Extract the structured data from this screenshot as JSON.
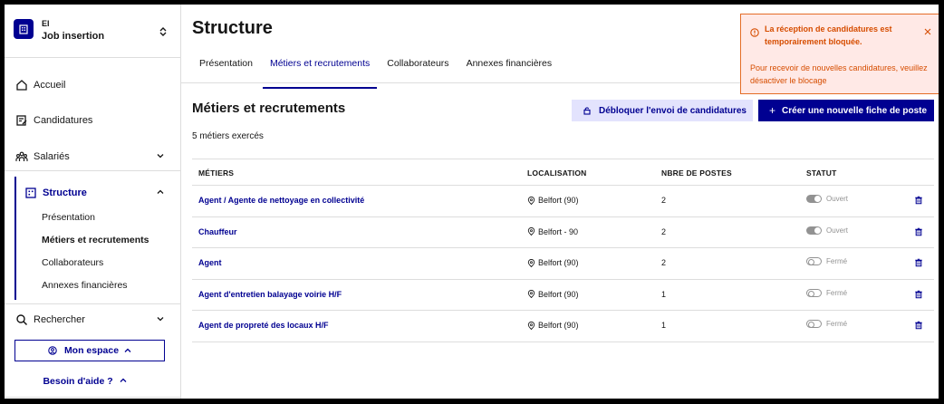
{
  "sidebar": {
    "org_short": "EI",
    "org_name": "Job insertion",
    "nav": {
      "accueil": "Accueil",
      "candidatures": "Candidatures",
      "salaries": "Salariés",
      "structure": "Structure",
      "rechercher": "Rechercher"
    },
    "structure_sub": [
      "Présentation",
      "Métiers et recrutements",
      "Collaborateurs",
      "Annexes financières"
    ],
    "mon_espace": "Mon espace",
    "besoin_aide": "Besoin d'aide ?"
  },
  "page": {
    "title": "Structure",
    "tabs": [
      "Présentation",
      "Métiers et recrutements",
      "Collaborateurs",
      "Annexes financières"
    ],
    "active_tab": "Métiers et recrutements",
    "section_title": "Métiers et recrutements",
    "count": "5 métiers exercés",
    "btn_unblock": "Débloquer l'envoi de candidatures",
    "btn_create": "Créer une nouvelle fiche de poste"
  },
  "table": {
    "headers": {
      "job": "MÉTIERS",
      "location": "LOCALISATION",
      "posts": "NBRE DE POSTES",
      "status": "STATUT"
    },
    "rows": [
      {
        "job": "Agent / Agente de nettoyage en collectivité",
        "location": "Belfort (90)",
        "posts": "2",
        "status": "Ouvert"
      },
      {
        "job": "Chauffeur",
        "location": "Belfort - 90",
        "posts": "2",
        "status": "Ouvert"
      },
      {
        "job": "Agent",
        "location": "Belfort (90)",
        "posts": "2",
        "status": "Fermé"
      },
      {
        "job": "Agent d'entretien balayage voirie H/F",
        "location": "Belfort (90)",
        "posts": "1",
        "status": "Fermé"
      },
      {
        "job": "Agent de propreté des locaux H/F",
        "location": "Belfort (90)",
        "posts": "1",
        "status": "Fermé"
      }
    ]
  },
  "alert": {
    "title": "La réception de candidatures est temporairement bloquée.",
    "body": "Pour recevoir de nouvelles candidatures, veuillez désactiver le blocage"
  },
  "colors": {
    "primary": "#000091",
    "alert_text": "#d64d00",
    "alert_bg": "#ffe9e6",
    "secondary_btn_bg": "#e3e3fd"
  },
  "icons": [
    "building-icon",
    "home-icon",
    "edit-document-icon",
    "team-icon",
    "search-icon",
    "user-circle-icon",
    "lock-icon",
    "map-pin-icon",
    "trash-icon",
    "warning-icon",
    "close-icon"
  ]
}
